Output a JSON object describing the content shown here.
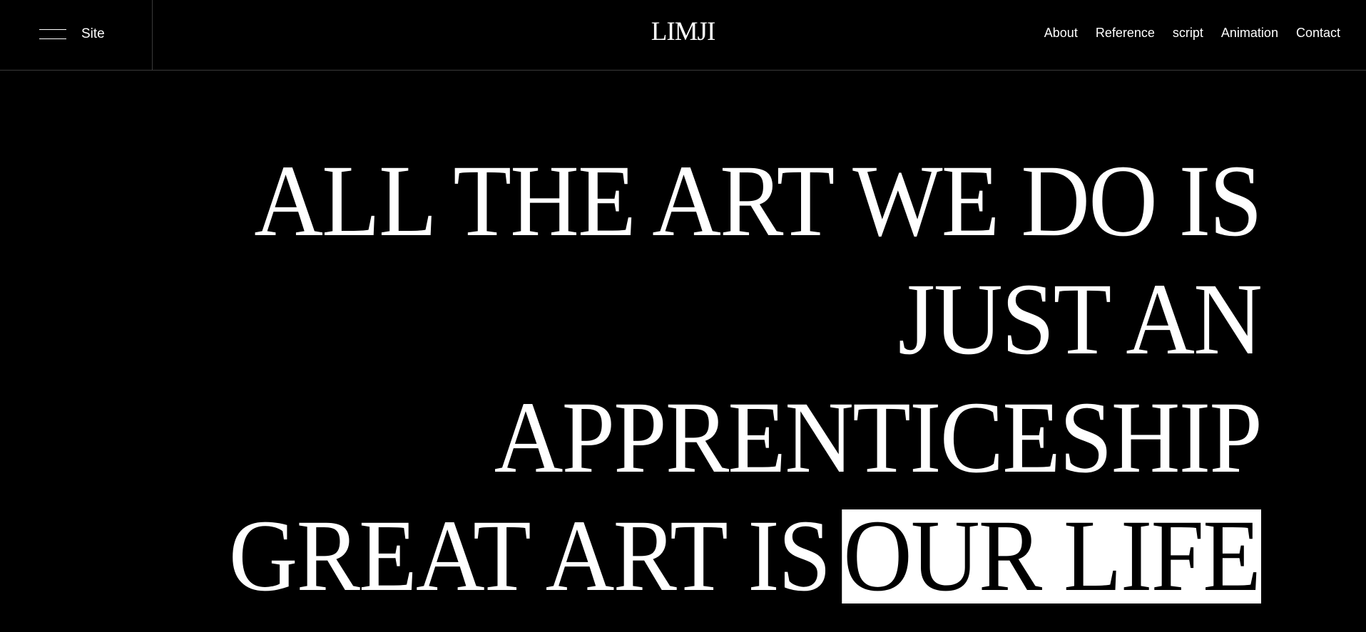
{
  "header": {
    "menu_label": "Site",
    "logo": "LIMJI",
    "nav": [
      {
        "label": "About"
      },
      {
        "label": "Reference"
      },
      {
        "label": "script"
      },
      {
        "label": "Animation"
      },
      {
        "label": "Contact"
      }
    ]
  },
  "hero": {
    "line1": "ALL THE ART WE DO IS",
    "line2": "JUST AN",
    "line3": "APPRENTICESHIP",
    "line4_plain": "GREAT ART IS",
    "line4_highlight": "OUR LIFE"
  },
  "colors": {
    "background": "#000000",
    "text": "#ffffff",
    "divider": "#3a3a3a",
    "highlight_bg": "#ffffff",
    "highlight_text": "#000000"
  },
  "icons": {
    "menu": "hamburger-icon"
  }
}
